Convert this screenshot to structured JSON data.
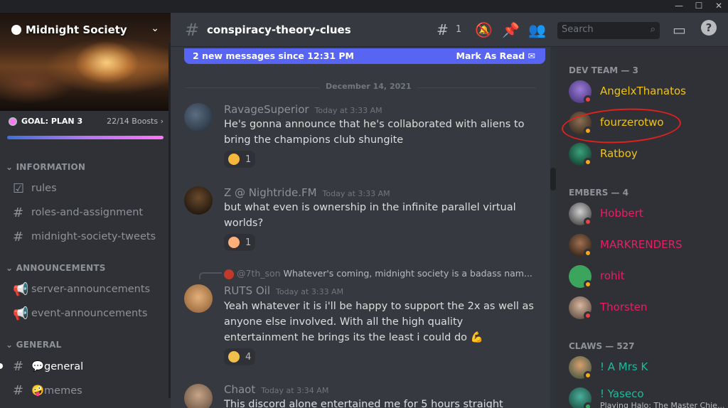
{
  "window": {
    "minimize": "—",
    "maximize": "☐",
    "close": "✕"
  },
  "server": {
    "name": "Midnight Society",
    "boost_goal": "GOAL: PLAN 3",
    "boost_count": "22/14 Boosts",
    "boost_progress": 1.0,
    "categories": [
      {
        "name": "INFORMATION",
        "channels": [
          "rules",
          "roles-and-assignment",
          "midnight-society-tweets"
        ]
      },
      {
        "name": "ANNOUNCEMENTS",
        "channels": [
          "server-announcements",
          "event-announcements"
        ]
      },
      {
        "name": "GENERAL",
        "channels": [
          "💬general",
          "🤪memes"
        ]
      }
    ]
  },
  "channel": {
    "title": "conspiracy-theory-clues",
    "threads_count": "1",
    "search_placeholder": "Search"
  },
  "new_messages": {
    "text": "2 new messages since 12:31 PM",
    "action": "Mark As Read"
  },
  "date_divider": "December 14, 2021",
  "messages": [
    {
      "user": "RavageSuperior",
      "time": "Today at 3:33 AM",
      "text": "He's gonna announce that he's collaborated with aliens to bring the champions club shungite",
      "reaction": "1",
      "color": "#8e9297"
    },
    {
      "user": "Z @ Nightride.FM",
      "time": "Today at 3:33 AM",
      "text": "but what even is ownership in the infinite parallel virtual worlds?",
      "reaction": "1",
      "color": "#8e9297"
    },
    {
      "reply_to": "@7th_son",
      "reply_text": "Whatever's coming, midnight society is a badass nam...",
      "user": "RUTS Oil",
      "time": "Today at 3:33 AM",
      "text": "Yeah whatever it is i'll be happy to support the 2x as well as anyone else involved. With all the high quality entertainment he brings its the least i could do 💪",
      "reaction": "4",
      "color": "#8e9297"
    },
    {
      "user": "Chaot",
      "time": "Today at 3:34 AM",
      "text": "This discord alone entertained me for 5 hours straight",
      "color": "#8e9297"
    }
  ],
  "members": {
    "groups": [
      {
        "title": "DEV TEAM — 3",
        "people": [
          {
            "name": "AngelxThanatos",
            "color": "#f1c40f",
            "status": "#ed4245"
          },
          {
            "name": "fourzerotwo",
            "color": "#f1c40f",
            "status": "#faa81a"
          },
          {
            "name": "Ratboy",
            "color": "#f1c40f",
            "status": "#faa81a"
          }
        ]
      },
      {
        "title": "EMBERS — 4",
        "people": [
          {
            "name": "Hobbert",
            "color": "#e91e63",
            "status": "#ed4245"
          },
          {
            "name": "MARKRENDERS",
            "color": "#e91e63",
            "status": "#faa81a"
          },
          {
            "name": "rohit",
            "color": "#e91e63",
            "status": "#faa81a"
          },
          {
            "name": "Thorsten",
            "color": "#e91e63",
            "status": "#ed4245"
          }
        ]
      },
      {
        "title": "CLAWS — 527",
        "people": [
          {
            "name": "! A Mrs K",
            "color": "#1abc9c",
            "status": "#faa81a"
          },
          {
            "name": "! Yaseco",
            "color": "#1abc9c",
            "status": "#3ba55d",
            "activity": "Playing Halo: The Master Chie..."
          }
        ]
      }
    ]
  },
  "colors": {
    "accent": "#5865f2",
    "highlight_circle": "#e0211c"
  }
}
